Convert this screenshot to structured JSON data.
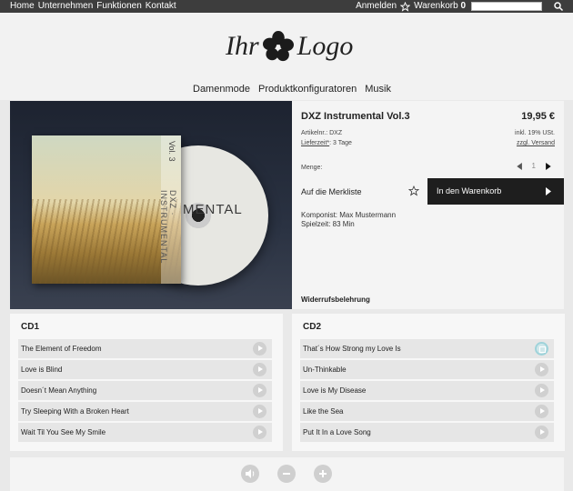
{
  "topbar": {
    "nav": [
      "Home",
      "Unternehmen",
      "Funktionen",
      "Kontakt"
    ],
    "login": "Anmelden",
    "cart_label": "Warenkorb",
    "cart_count": "0",
    "search_value": ""
  },
  "logo": {
    "left": "Ihr",
    "right": "Logo"
  },
  "mainnav": [
    "Damenmode",
    "Produktkonfiguratoren",
    "Musik"
  ],
  "product": {
    "title": "DXZ Instrumental Vol.3",
    "price": "19,95 €",
    "article_label": "Artikelnr.: DXZ",
    "tax": "inkl. 19% USt.",
    "delivery_label": "Lieferzeit*",
    "delivery_value": ": 3 Tage",
    "shipping": "zzgl. Versand",
    "quantity_label": "Menge:",
    "quantity": "1",
    "wishlist": "Auf die Merkliste",
    "add_to_cart": "In den Warenkorb",
    "composer": "Komponist: Max Mustermann",
    "playtime": "Spielzeit: 83 Min",
    "withdrawal": "Widerrufsbelehrung",
    "cover": {
      "disc_text": "MENTAL",
      "spine_text": "DXZ · INSTRUMENTAL",
      "volume": "Vol. 3"
    }
  },
  "cd1": {
    "title": "CD1",
    "tracks": [
      "The Element of Freedom",
      "Love is Blind",
      "Doesn´t Mean Anything",
      "Try Sleeping With a Broken Heart",
      "Wait Til You See My Smile"
    ]
  },
  "cd2": {
    "title": "CD2",
    "tracks": [
      "That´s How Strong my Love Is",
      "Un-Thinkable",
      "Love is My Disease",
      "Like the Sea",
      "Put It In a Love Song"
    ]
  },
  "colors": {
    "topbar": "#3d3d3d",
    "cart_button": "#1e1e1e",
    "accent_playing": "#9fd3da"
  }
}
